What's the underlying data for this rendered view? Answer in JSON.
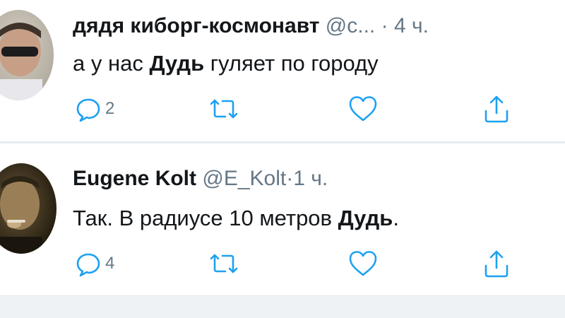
{
  "tweets": [
    {
      "author": "дядя киборг-космонавт",
      "handle": "@с...",
      "separator": "·",
      "time": "4 ч.",
      "text_before": "а у нас ",
      "text_bold": "Дудь",
      "text_after": " гуляет по городу",
      "reply_count": "2",
      "icons": {
        "reply": "reply-icon",
        "retweet": "retweet-icon",
        "like": "like-icon",
        "share": "share-icon"
      }
    },
    {
      "author": "Eugene Kolt",
      "handle": "@E_Kolt",
      "separator": "·",
      "time": "1 ч.",
      "text_before": "Так. В радиусе 10 метров ",
      "text_bold": "Дудь",
      "text_after": ".",
      "reply_count": "4",
      "icons": {
        "reply": "reply-icon",
        "retweet": "retweet-icon",
        "like": "like-icon",
        "share": "share-icon"
      }
    }
  ],
  "colors": {
    "text": "#14171a",
    "secondary": "#657786",
    "icon": "#1da1f2",
    "divider": "#e6ecf0"
  }
}
